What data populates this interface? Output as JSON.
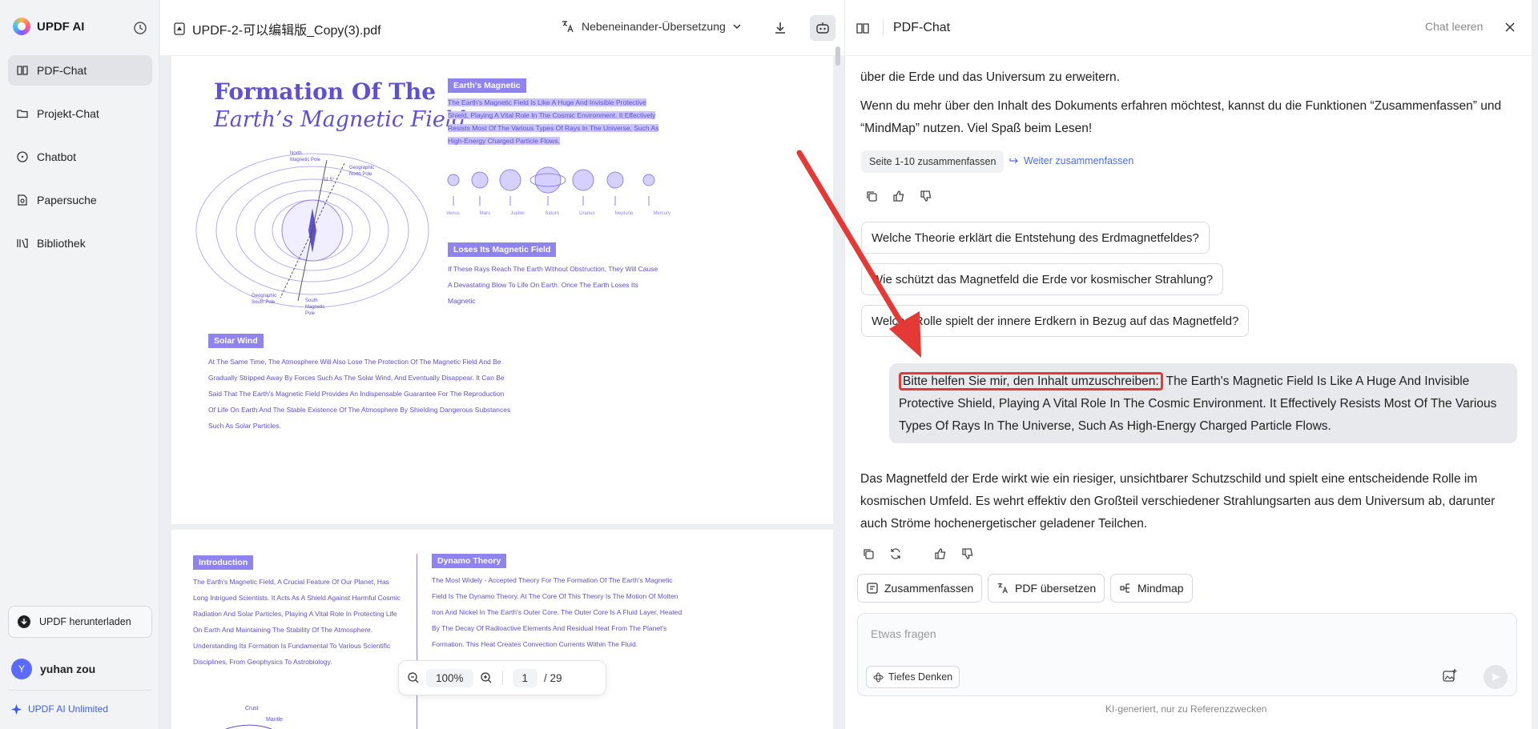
{
  "app": {
    "name": "UPDF AI"
  },
  "sidebar": {
    "items": [
      {
        "label": "PDF-Chat"
      },
      {
        "label": "Projekt-Chat"
      },
      {
        "label": "Chatbot"
      },
      {
        "label": "Papersuche"
      },
      {
        "label": "Bibliothek"
      }
    ],
    "download_label": "UPDF herunterladen",
    "user": {
      "initial": "Y",
      "name": "yuhan zou"
    },
    "unlimited_label": "UPDF AI Unlimited"
  },
  "document": {
    "file_name": "UPDF-2-可以编辑版_Copy(3).pdf",
    "translation_mode": "Nebeneinander-Übersetzung",
    "page1": {
      "title_line1": "Formation Of The",
      "title_line2": "Earth’s Magnetic Field",
      "earth_badge": "Earth's Magnetic",
      "earth_text": "The Earth's Magnetic Field Is Like A Huge And Invisible Protective Shield, Playing A Vital Role In The Cosmic Environment. It Effectively Resists Most Of The Various Types Of Rays In The Universe, Such As High-Energy Charged Particle Flows.",
      "planets": [
        "Venus",
        "Mars",
        "Jupiter",
        "Saturn",
        "Uranus",
        "Neptune",
        "Mercury"
      ],
      "diagram_labels": {
        "north_magnetic": "North Magnetic Pole",
        "geo_north": "Geographic North Pole",
        "geo_south": "Geographic South Pole",
        "south_magnetic": "South Magnetic Pole",
        "angle": "11.5°"
      },
      "loses_badge": "Loses Its Magnetic Field",
      "loses_text": "If These Rays Reach The Earth Without Obstruction, They Will Cause A Devastating Blow To Life On Earth. Once The Earth Loses Its Magnetic",
      "solar_badge": "Solar Wind",
      "solar_text": "At The Same Time, The Atmosphere Will Also Lose The Protection Of The Magnetic Field And Be Gradually Stripped Away By Forces Such As The Solar Wind, And Eventually Disappear. It Can Be Said That The Earth's Magnetic Field Provides An Indispensable Guarantee For The Reproduction Of Life On Earth And The Stable Existence Of The Atmosphere By Shielding Dangerous Substances Such As Solar Particles."
    },
    "page2": {
      "intro_badge": "Introduction",
      "intro_text": "The Earth's Magnetic Field, A Crucial Feature Of Our Planet, Has Long Intrigued Scientists. It Acts As A Shield Against Harmful Cosmic Radiation And Solar Particles, Playing A Vital Role In Protecting Life On Earth And Maintaining The Stability Of The Atmosphere. Understanding Its Formation Is Fundamental To Various Scientific Disciplines, From Geophysics To Astrobiology.",
      "dynamo_badge": "Dynamo Theory",
      "dynamo_text": "The Most Widely - Accepted Theory For The Formation Of The Earth's Magnetic Field Is The Dynamo Theory. At The Core Of This Theory Is The Motion Of Molten Iron And Nickel In The Earth's Outer Core. The Outer Core Is A Fluid Layer, Heated By The Decay Of Radioactive Elements And Residual Heat From The Planet's Formation. This Heat Creates Convection Currents Within The Fluid.",
      "crust": "Crust",
      "mantle": "Mantle"
    },
    "zoom": "100%",
    "page_current": "1",
    "page_total": "/ 29"
  },
  "chat": {
    "title": "PDF-Chat",
    "clear_label": "Chat leeren",
    "intro_tail": "über die Erde und das Universum zu erweitern.",
    "intro_tip": "Wenn du mehr über den Inhalt des Dokuments erfahren möchtest, kannst du die Funktionen “Zusammenfassen” und “MindMap” nutzen. Viel Spaß beim Lesen!",
    "summary_chip": "Seite 1-10 zusammenfassen",
    "summary_link": "Weiter zusammenfassen",
    "suggestions": [
      "Welche Theorie erklärt die Entstehung des Erdmagnetfeldes?",
      "Wie schützt das Magnetfeld die Erde vor kosmischer Strahlung?",
      "Welche Rolle spielt der innere Erdkern in Bezug auf das Magnetfeld?"
    ],
    "user_prompt": "Bitte helfen Sie mir, den Inhalt umzuschreiben:",
    "user_text": " The Earth's Magnetic Field Is Like A Huge And Invisible Protective Shield, Playing A Vital Role In The Cosmic Environment. It Effectively Resists Most Of The Various Types Of Rays In The Universe, Such As High-Energy Charged Particle Flows.",
    "answer": "Das Magnetfeld der Erde wirkt wie ein riesiger, unsichtbarer Schutzschild und spielt eine entscheidende Rolle im kosmischen Umfeld. Es wehrt effektiv den Großteil verschiedener Strahlungsarten aus dem Universum ab, darunter auch Ströme hochenergetischer geladener Teilchen.",
    "actions": [
      "Zusammenfassen",
      "PDF übersetzen",
      "Mindmap"
    ],
    "input_placeholder": "Etwas fragen",
    "deep_label": "Tiefes Denken",
    "footer": "KI-generiert, nur zu Referenzzwecken"
  },
  "colors": {
    "accent": "#4a6cf7",
    "doc_purple": "#5e4fd6",
    "highlight": "#c9c2ff",
    "annotation_red": "#e53935"
  }
}
